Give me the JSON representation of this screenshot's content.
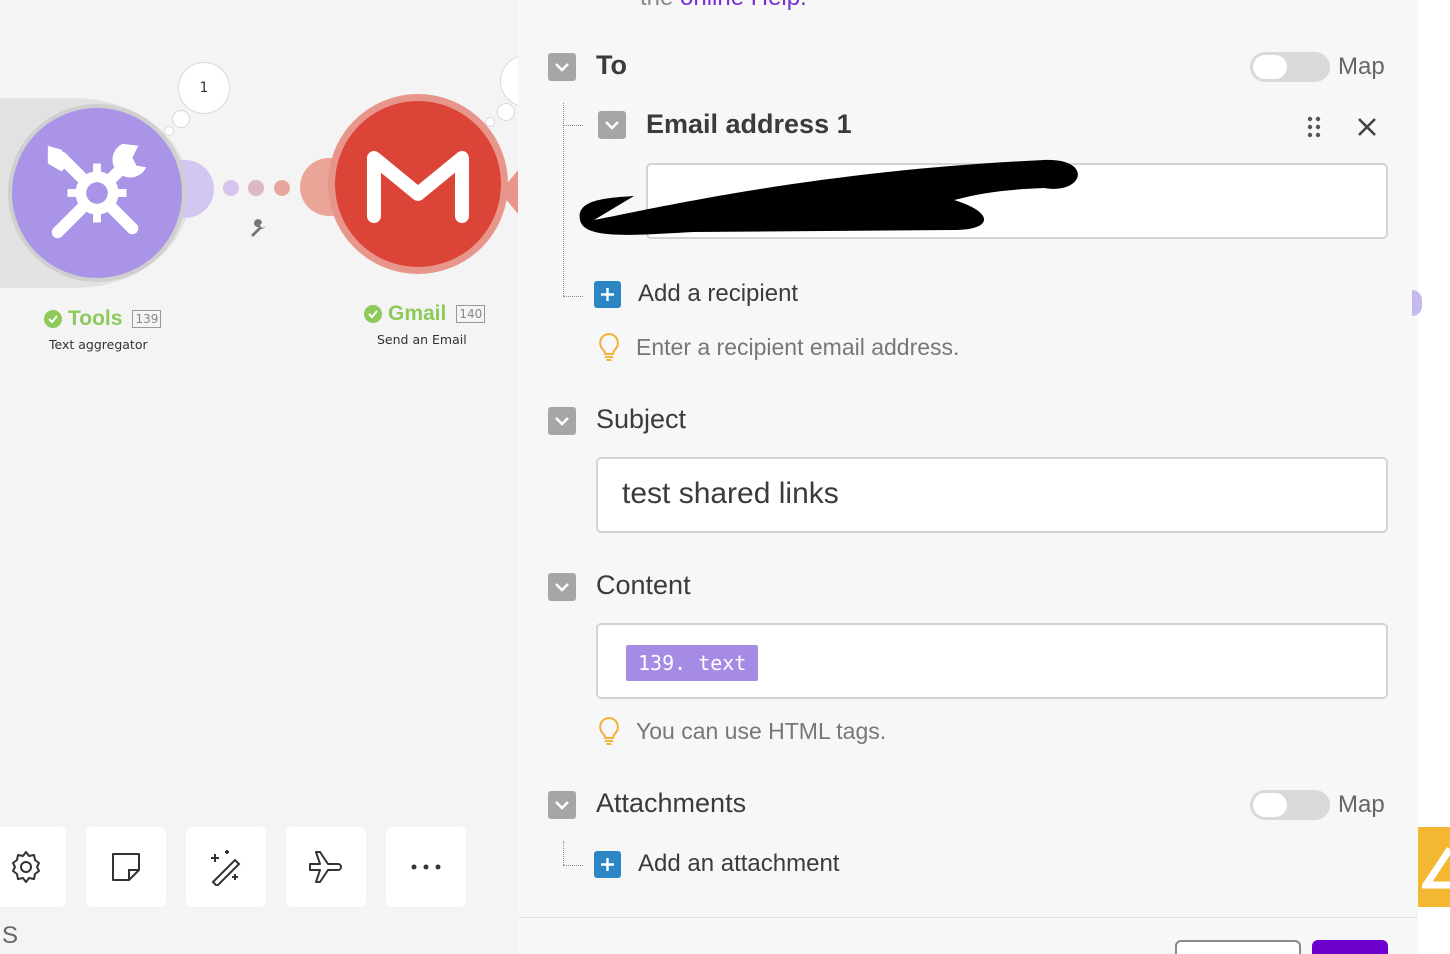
{
  "canvas": {
    "bubble_count": "1",
    "tools_module": {
      "name": "Tools",
      "id": "139",
      "subtitle": "Text aggregator"
    },
    "gmail_module": {
      "name": "Gmail",
      "id": "140",
      "subtitle": "Send an Email"
    },
    "bottom_partial_text": "S",
    "toolbar": [
      "gear-icon",
      "note-icon",
      "magic-wand-icon",
      "airplane-icon",
      "more-icon"
    ]
  },
  "panel": {
    "top_partial_text": "the ",
    "top_partial_link": "online Help.",
    "to": {
      "label": "To",
      "map_label": "Map",
      "map_enabled": false
    },
    "email_item": {
      "label": "Email address 1",
      "value": ""
    },
    "add_recipient": "Add a recipient",
    "recipient_hint": "Enter a recipient email address.",
    "subject": {
      "label": "Subject",
      "value": "test shared links"
    },
    "content": {
      "label": "Content",
      "token": "139. text"
    },
    "content_hint": "You can use HTML tags.",
    "attachments": {
      "label": "Attachments",
      "map_label": "Map",
      "map_enabled": false
    },
    "add_attachment": "Add an attachment"
  },
  "colors": {
    "tools_purple": "#a994e8",
    "gmail_red": "#db4437",
    "success_green": "#8dc95b",
    "plus_blue": "#2d86c4",
    "token_purple": "#a68be4",
    "primary_purple": "#6d00cc",
    "link_purple": "#7a2fd6"
  }
}
